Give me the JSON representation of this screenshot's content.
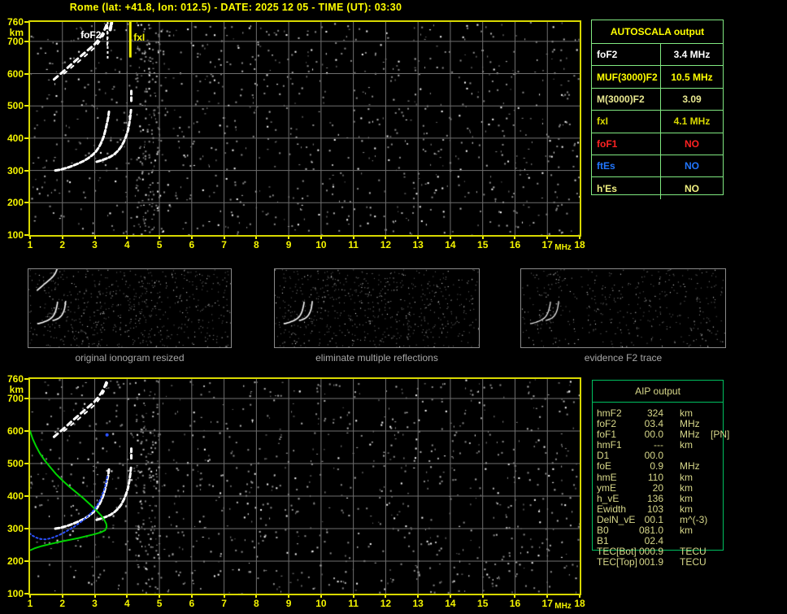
{
  "title": "Rome (lat: +41.8, lon: 012.5) - DATE: 2025 12 05 - TIME (UT): 03:30",
  "colors": {
    "background": "#000000",
    "title_text": "#ffff00",
    "axis_text": "#f3f300",
    "plot_border": "#d8d800",
    "grid": "#6e6e6e",
    "trace_white": "#ffffff",
    "profile_green": "#00d200",
    "restored_trace_blue": "#2a50ff",
    "autoscala_border": "#80e880",
    "aip_border": "#00c060",
    "aip_text": "#d8d88a",
    "thumb_border": "#8a8a8a",
    "thumb_caption": "#a8a8a8"
  },
  "autoscala_table": {
    "header": "AUTOSCALA output",
    "rows": [
      {
        "label": "foF2",
        "value": "3.4 MHz",
        "color": "#ffffff"
      },
      {
        "label": "MUF(3000)F2",
        "value": "10.5 MHz",
        "color": "#ffff00"
      },
      {
        "label": "M(3000)F2",
        "value": "3.09",
        "color": "#e8e890"
      },
      {
        "label": "fxI",
        "value": "4.1 MHz",
        "color": "#d9d900"
      },
      {
        "label": "foF1",
        "value": "NO",
        "color": "#ff2222"
      },
      {
        "label": "ftEs",
        "value": "NO",
        "color": "#2277ff"
      },
      {
        "label": "h'Es",
        "value": "NO",
        "color": "#f0f080"
      }
    ]
  },
  "aip_table": {
    "header": "AIP output",
    "rows": [
      {
        "label": "hmF2",
        "value": "324",
        "unit": "km",
        "note": ""
      },
      {
        "label": "foF2",
        "value": "03.4",
        "unit": "MHz",
        "note": ""
      },
      {
        "label": "foF1",
        "value": "00.0",
        "unit": "MHz",
        "note": "[PN]"
      },
      {
        "label": "hmF1",
        "value": "---",
        "unit": "km",
        "note": ""
      },
      {
        "label": "D1",
        "value": "00.0",
        "unit": "",
        "note": ""
      },
      {
        "label": "foE",
        "value": "0.9",
        "unit": "MHz",
        "note": ""
      },
      {
        "label": "hmE",
        "value": "110",
        "unit": "km",
        "note": ""
      },
      {
        "label": "ymE",
        "value": "20",
        "unit": "km",
        "note": ""
      },
      {
        "label": "h_vE",
        "value": "136",
        "unit": "km",
        "note": ""
      },
      {
        "label": "Ewidth",
        "value": "103",
        "unit": "km",
        "note": ""
      },
      {
        "label": "DelN_vE",
        "value": "00.1",
        "unit": "m^(-3)",
        "note": ""
      },
      {
        "label": "B0",
        "value": "081.0",
        "unit": "km",
        "note": ""
      },
      {
        "label": "B1",
        "value": "02.4",
        "unit": "",
        "note": ""
      },
      {
        "label": "TEC[Bot]",
        "value": "000.9",
        "unit": "TECU",
        "note": ""
      },
      {
        "label": "TEC[Top]",
        "value": "001.9",
        "unit": "TECU",
        "note": ""
      }
    ]
  },
  "thumbnails": [
    {
      "caption": "original ionogram resized"
    },
    {
      "caption": "eliminate multiple reflections"
    },
    {
      "caption": "evidence F2 trace"
    }
  ],
  "chart_data": [
    {
      "id": "main-ionogram",
      "type": "scatter",
      "title": "",
      "xlabel": "MHz",
      "ylabel": "km",
      "xlim": [
        1,
        18
      ],
      "ylim": [
        100,
        760
      ],
      "xticks": [
        1,
        2,
        3,
        4,
        5,
        6,
        7,
        8,
        9,
        10,
        11,
        12,
        13,
        14,
        15,
        16,
        17,
        18
      ],
      "yticks": [
        760,
        700,
        600,
        500,
        400,
        300,
        200,
        100
      ],
      "grid": true,
      "annotations": [
        {
          "name": "foF2-line",
          "label": "foF2",
          "x_mhz": 3.4,
          "y_km_from": 645,
          "y_km_to": 760,
          "color": "#ffffff",
          "style": "dashed",
          "width": 2,
          "label_side": "left"
        },
        {
          "name": "fxI-line",
          "label": "fxI",
          "x_mhz": 4.1,
          "y_km_from": 650,
          "y_km_to": 760,
          "color": "#f3f300",
          "style": "solid",
          "width": 3,
          "label_side": "right"
        }
      ],
      "series": [
        {
          "name": "F2 ordinary echo trace",
          "color": "#ffffff",
          "width": 3,
          "dash": "5 3",
          "points": [
            [
              1.78,
              300
            ],
            [
              1.92,
              302
            ],
            [
              2.06,
              306
            ],
            [
              2.2,
              310
            ],
            [
              2.35,
              316
            ],
            [
              2.5,
              322
            ],
            [
              2.65,
              329
            ],
            [
              2.8,
              338
            ],
            [
              2.93,
              348
            ],
            [
              3.04,
              359
            ],
            [
              3.13,
              372
            ],
            [
              3.21,
              388
            ],
            [
              3.28,
              406
            ],
            [
              3.33,
              425
            ],
            [
              3.38,
              446
            ],
            [
              3.42,
              465
            ],
            [
              3.44,
              482
            ]
          ]
        },
        {
          "name": "F2 extraordinary echo trace",
          "color": "#ffffff",
          "width": 3,
          "dash": "5 3",
          "points": [
            [
              3.06,
              327
            ],
            [
              3.2,
              331
            ],
            [
              3.34,
              336
            ],
            [
              3.48,
              342
            ],
            [
              3.6,
              350
            ],
            [
              3.72,
              361
            ],
            [
              3.82,
              374
            ],
            [
              3.9,
              389
            ],
            [
              3.97,
              406
            ],
            [
              4.03,
              425
            ],
            [
              4.07,
              447
            ],
            [
              4.1,
              468
            ],
            [
              4.12,
              487
            ]
          ]
        },
        {
          "name": "F2 extraordinary cusp segment",
          "color": "#ffffff",
          "width": 3,
          "dash": "4 4",
          "points": [
            [
              4.13,
              516
            ],
            [
              4.13,
              556
            ]
          ]
        },
        {
          "name": "second-hop multiple trace",
          "color": "#ffffff",
          "width": 3,
          "dash": "6 5",
          "points": [
            [
              1.74,
              582
            ],
            [
              1.88,
              594
            ],
            [
              2.02,
              606
            ],
            [
              2.16,
              618
            ],
            [
              2.3,
              631
            ],
            [
              2.44,
              643
            ],
            [
              2.58,
              655
            ],
            [
              2.72,
              667
            ],
            [
              2.86,
              679
            ],
            [
              3.0,
              691
            ],
            [
              3.1,
              703
            ],
            [
              3.2,
              717
            ],
            [
              3.29,
              733
            ],
            [
              3.36,
              750
            ],
            [
              3.4,
              760
            ]
          ]
        },
        {
          "name": "second-hop multiple trace b",
          "color": "#ffffff",
          "width": 2,
          "dash": "4 7",
          "points": [
            [
              2.05,
              600
            ],
            [
              2.2,
              612
            ],
            [
              2.35,
              625
            ],
            [
              2.5,
              637
            ],
            [
              2.65,
              650
            ],
            [
              2.8,
              663
            ],
            [
              2.95,
              676
            ],
            [
              3.08,
              690
            ],
            [
              3.18,
              704
            ],
            [
              3.27,
              719
            ],
            [
              3.35,
              736
            ],
            [
              3.41,
              754
            ]
          ]
        },
        {
          "name": "near-foF2 vertical scatter",
          "color": "#ffffff",
          "width": 2,
          "dash": "3 4",
          "points": [
            [
              3.39,
              688
            ],
            [
              3.39,
              758
            ]
          ]
        },
        {
          "name": "top blob",
          "color": "#ffffff",
          "width": 4,
          "dash": "4 3",
          "points": [
            [
              3.48,
              736
            ],
            [
              3.52,
              757
            ]
          ]
        }
      ],
      "noise": {
        "seed": 42,
        "count": 1000,
        "band_mhz": [
          4.25,
          5.0
        ],
        "band_count": 150
      }
    },
    {
      "id": "inversion-ionogram",
      "type": "scatter",
      "title": "",
      "xlabel": "MHz",
      "ylabel": "km",
      "xlim": [
        1,
        18
      ],
      "ylim": [
        100,
        760
      ],
      "xticks": [
        1,
        2,
        3,
        4,
        5,
        6,
        7,
        8,
        9,
        10,
        11,
        12,
        13,
        14,
        15,
        16,
        17,
        18
      ],
      "yticks": [
        760,
        700,
        600,
        500,
        400,
        300,
        200,
        100
      ],
      "grid": true,
      "annotations": [],
      "series": [
        {
          "name": "F2 ordinary echo trace",
          "color": "#ffffff",
          "width": 3,
          "dash": "5 3",
          "points": [
            [
              1.78,
              300
            ],
            [
              1.92,
              302
            ],
            [
              2.06,
              306
            ],
            [
              2.2,
              310
            ],
            [
              2.35,
              316
            ],
            [
              2.5,
              322
            ],
            [
              2.65,
              329
            ],
            [
              2.8,
              338
            ],
            [
              2.93,
              348
            ],
            [
              3.04,
              359
            ],
            [
              3.13,
              372
            ],
            [
              3.21,
              388
            ],
            [
              3.28,
              406
            ],
            [
              3.33,
              425
            ],
            [
              3.38,
              446
            ],
            [
              3.42,
              465
            ],
            [
              3.44,
              482
            ]
          ]
        },
        {
          "name": "F2 extraordinary echo trace",
          "color": "#ffffff",
          "width": 3,
          "dash": "5 3",
          "points": [
            [
              3.06,
              327
            ],
            [
              3.2,
              331
            ],
            [
              3.34,
              336
            ],
            [
              3.48,
              342
            ],
            [
              3.6,
              350
            ],
            [
              3.72,
              361
            ],
            [
              3.82,
              374
            ],
            [
              3.9,
              389
            ],
            [
              3.97,
              406
            ],
            [
              4.03,
              425
            ],
            [
              4.07,
              447
            ],
            [
              4.1,
              468
            ],
            [
              4.12,
              487
            ]
          ]
        },
        {
          "name": "F2 extraordinary cusp segment",
          "color": "#ffffff",
          "width": 3,
          "dash": "4 4",
          "points": [
            [
              4.13,
              516
            ],
            [
              4.13,
              556
            ]
          ]
        },
        {
          "name": "second-hop multiple trace",
          "color": "#ffffff",
          "width": 3,
          "dash": "6 5",
          "points": [
            [
              1.74,
              582
            ],
            [
              1.88,
              594
            ],
            [
              2.02,
              606
            ],
            [
              2.16,
              618
            ],
            [
              2.3,
              631
            ],
            [
              2.44,
              643
            ],
            [
              2.58,
              655
            ],
            [
              2.72,
              667
            ],
            [
              2.86,
              679
            ],
            [
              3.0,
              691
            ],
            [
              3.1,
              703
            ],
            [
              3.2,
              717
            ],
            [
              3.29,
              733
            ],
            [
              3.36,
              750
            ],
            [
              3.4,
              760
            ]
          ]
        },
        {
          "name": "second-hop multiple trace b",
          "color": "#ffffff",
          "width": 2,
          "dash": "4 7",
          "points": [
            [
              2.05,
              600
            ],
            [
              2.2,
              612
            ],
            [
              2.35,
              625
            ],
            [
              2.5,
              637
            ],
            [
              2.65,
              650
            ],
            [
              2.8,
              663
            ],
            [
              2.95,
              676
            ],
            [
              3.08,
              690
            ],
            [
              3.18,
              704
            ],
            [
              3.27,
              719
            ],
            [
              3.35,
              736
            ],
            [
              3.41,
              754
            ]
          ]
        },
        {
          "name": "electron density profile",
          "color": "#00d200",
          "width": 2,
          "dash": "",
          "points": [
            [
              1.0,
              600
            ],
            [
              1.08,
              576
            ],
            [
              1.18,
              554
            ],
            [
              1.3,
              532
            ],
            [
              1.45,
              510
            ],
            [
              1.62,
              489
            ],
            [
              1.8,
              468
            ],
            [
              2.0,
              448
            ],
            [
              2.2,
              430
            ],
            [
              2.42,
              412
            ],
            [
              2.64,
              394
            ],
            [
              2.86,
              374
            ],
            [
              3.05,
              356
            ],
            [
              3.2,
              340
            ],
            [
              3.3,
              326
            ],
            [
              3.36,
              314
            ],
            [
              3.37,
              305
            ],
            [
              3.32,
              295
            ],
            [
              3.2,
              289
            ],
            [
              3.0,
              283
            ],
            [
              2.75,
              277
            ],
            [
              2.5,
              271
            ],
            [
              2.2,
              265
            ],
            [
              1.9,
              259
            ],
            [
              1.6,
              252
            ],
            [
              1.35,
              246
            ],
            [
              1.15,
              240
            ],
            [
              1.02,
              234
            ]
          ]
        },
        {
          "name": "restored F2 trace",
          "color": "#2a50ff",
          "width": 2,
          "dash": "2 3",
          "points": [
            [
              0.98,
              286
            ],
            [
              1.08,
              278
            ],
            [
              1.2,
              272
            ],
            [
              1.33,
              268
            ],
            [
              1.48,
              267
            ],
            [
              1.63,
              270
            ],
            [
              1.8,
              276
            ],
            [
              1.98,
              284
            ],
            [
              2.16,
              294
            ],
            [
              2.35,
              305
            ],
            [
              2.54,
              318
            ],
            [
              2.72,
              332
            ],
            [
              2.88,
              347
            ],
            [
              3.02,
              363
            ],
            [
              3.13,
              381
            ],
            [
              3.22,
              401
            ],
            [
              3.3,
              423
            ],
            [
              3.36,
              446
            ],
            [
              3.4,
              466
            ]
          ]
        },
        {
          "name": "restored trace stray point",
          "color": "#2a50ff",
          "width": 3,
          "dash": "",
          "points": [
            [
              3.38,
              588
            ]
          ]
        }
      ],
      "noise": {
        "seed": 77,
        "count": 1000,
        "band_mhz": [
          4.25,
          5.0
        ],
        "band_count": 130
      }
    }
  ]
}
